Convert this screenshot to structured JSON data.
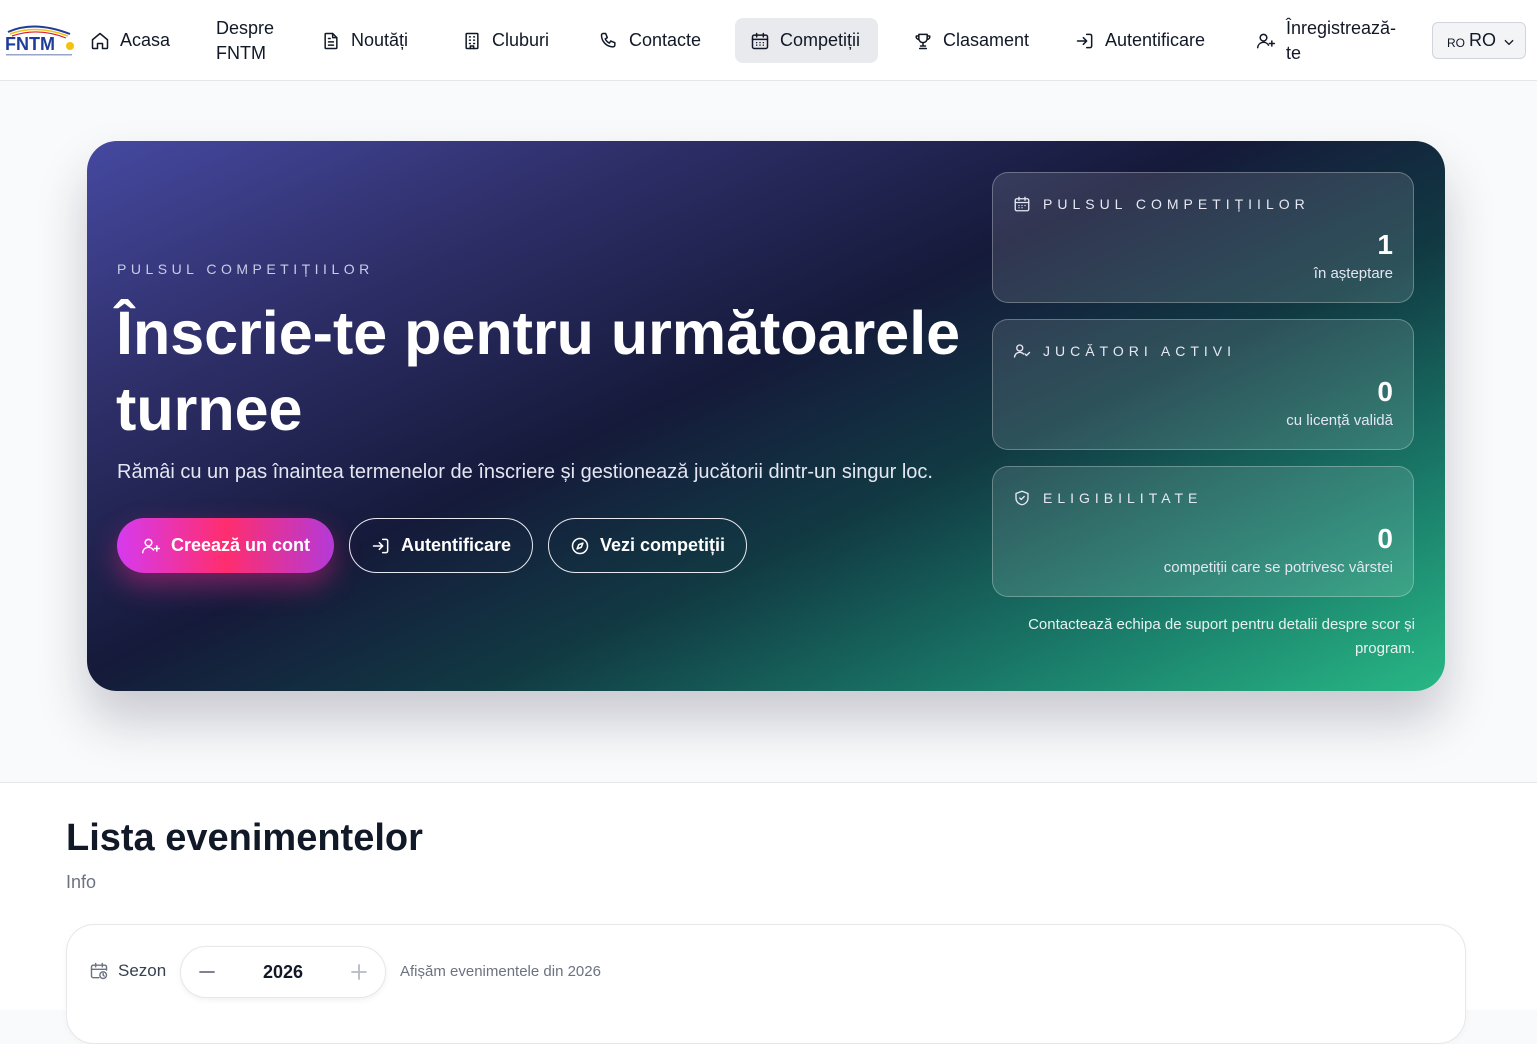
{
  "nav": {
    "logo_text": "FNTM",
    "items": [
      {
        "label": "Acasa",
        "icon": "home-icon"
      },
      {
        "label_line1": "Despre",
        "label_line2": "FNTM"
      },
      {
        "label": "Noutăți",
        "icon": "document-icon"
      },
      {
        "label": "Cluburi",
        "icon": "building-icon"
      },
      {
        "label": "Contacte",
        "icon": "phone-icon"
      },
      {
        "label": "Competiții",
        "icon": "calendar-icon",
        "active": true
      },
      {
        "label": "Clasament",
        "icon": "trophy-icon"
      },
      {
        "label": "Autentificare",
        "icon": "login-icon"
      },
      {
        "label_line1": "Înregistrează-",
        "label_line2": "te",
        "icon": "user-plus-icon"
      }
    ],
    "language": {
      "code_small": "RO",
      "code": "RO"
    }
  },
  "hero": {
    "eyebrow": "PULSUL COMPETIȚIILOR",
    "title": "Înscrie-te pentru următoarele turnee",
    "description": "Rămâi cu un pas înaintea termenelor de înscriere și gestionează jucătorii dintr-un singur loc.",
    "buttons": {
      "create_account": "Creează un cont",
      "login": "Autentificare",
      "view_competitions": "Vezi competiții"
    },
    "stats": [
      {
        "label": "PULSUL COMPETIȚIILOR",
        "value": "1",
        "caption": "în așteptare",
        "icon": "calendar-icon"
      },
      {
        "label": "JUCĂTORI ACTIVI",
        "value": "0",
        "caption": "cu licență validă",
        "icon": "user-check-icon"
      },
      {
        "label": "ELIGIBILITATE",
        "value": "0",
        "caption": "competiții care se potrivesc vârstei",
        "icon": "shield-check-icon"
      }
    ],
    "note": "Contactează echipa de suport pentru detalii despre scor și program."
  },
  "events": {
    "title": "Lista evenimentelor",
    "info": "Info",
    "season_label": "Sezon",
    "season_value": "2026",
    "season_note": "Afișăm evenimentele din 2026"
  },
  "colors": {
    "accent_pink": "#ff2d6e",
    "accent_purple": "#d63aef",
    "hero_dark": "#151a3a",
    "hero_green": "#28b885",
    "active_nav_bg": "#e9eaee"
  }
}
